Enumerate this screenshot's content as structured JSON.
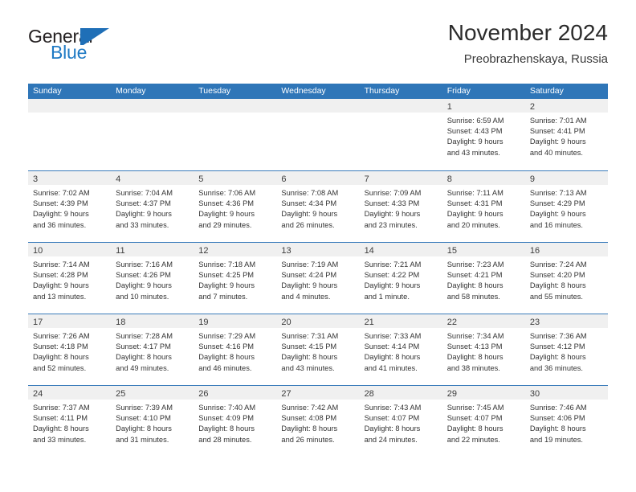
{
  "brand": {
    "name_part1": "General",
    "name_part2": "Blue",
    "mark": "blue-triangle-logo",
    "color_dark": "#231f20",
    "color_blue": "#1f7ac4"
  },
  "header": {
    "title": "November 2024",
    "location": "Preobrazhenskaya, Russia"
  },
  "theme": {
    "header_blue": "#2f76b8",
    "daynum_band": "#f0f0f0",
    "row_divider": "#3b7cbb",
    "text": "#333333"
  },
  "weekdays": [
    "Sunday",
    "Monday",
    "Tuesday",
    "Wednesday",
    "Thursday",
    "Friday",
    "Saturday"
  ],
  "weeks": [
    [
      {
        "day": "",
        "sunrise": "",
        "sunset": "",
        "daylight1": "",
        "daylight2": ""
      },
      {
        "day": "",
        "sunrise": "",
        "sunset": "",
        "daylight1": "",
        "daylight2": ""
      },
      {
        "day": "",
        "sunrise": "",
        "sunset": "",
        "daylight1": "",
        "daylight2": ""
      },
      {
        "day": "",
        "sunrise": "",
        "sunset": "",
        "daylight1": "",
        "daylight2": ""
      },
      {
        "day": "",
        "sunrise": "",
        "sunset": "",
        "daylight1": "",
        "daylight2": ""
      },
      {
        "day": "1",
        "sunrise": "Sunrise: 6:59 AM",
        "sunset": "Sunset: 4:43 PM",
        "daylight1": "Daylight: 9 hours",
        "daylight2": "and 43 minutes."
      },
      {
        "day": "2",
        "sunrise": "Sunrise: 7:01 AM",
        "sunset": "Sunset: 4:41 PM",
        "daylight1": "Daylight: 9 hours",
        "daylight2": "and 40 minutes."
      }
    ],
    [
      {
        "day": "3",
        "sunrise": "Sunrise: 7:02 AM",
        "sunset": "Sunset: 4:39 PM",
        "daylight1": "Daylight: 9 hours",
        "daylight2": "and 36 minutes."
      },
      {
        "day": "4",
        "sunrise": "Sunrise: 7:04 AM",
        "sunset": "Sunset: 4:37 PM",
        "daylight1": "Daylight: 9 hours",
        "daylight2": "and 33 minutes."
      },
      {
        "day": "5",
        "sunrise": "Sunrise: 7:06 AM",
        "sunset": "Sunset: 4:36 PM",
        "daylight1": "Daylight: 9 hours",
        "daylight2": "and 29 minutes."
      },
      {
        "day": "6",
        "sunrise": "Sunrise: 7:08 AM",
        "sunset": "Sunset: 4:34 PM",
        "daylight1": "Daylight: 9 hours",
        "daylight2": "and 26 minutes."
      },
      {
        "day": "7",
        "sunrise": "Sunrise: 7:09 AM",
        "sunset": "Sunset: 4:33 PM",
        "daylight1": "Daylight: 9 hours",
        "daylight2": "and 23 minutes."
      },
      {
        "day": "8",
        "sunrise": "Sunrise: 7:11 AM",
        "sunset": "Sunset: 4:31 PM",
        "daylight1": "Daylight: 9 hours",
        "daylight2": "and 20 minutes."
      },
      {
        "day": "9",
        "sunrise": "Sunrise: 7:13 AM",
        "sunset": "Sunset: 4:29 PM",
        "daylight1": "Daylight: 9 hours",
        "daylight2": "and 16 minutes."
      }
    ],
    [
      {
        "day": "10",
        "sunrise": "Sunrise: 7:14 AM",
        "sunset": "Sunset: 4:28 PM",
        "daylight1": "Daylight: 9 hours",
        "daylight2": "and 13 minutes."
      },
      {
        "day": "11",
        "sunrise": "Sunrise: 7:16 AM",
        "sunset": "Sunset: 4:26 PM",
        "daylight1": "Daylight: 9 hours",
        "daylight2": "and 10 minutes."
      },
      {
        "day": "12",
        "sunrise": "Sunrise: 7:18 AM",
        "sunset": "Sunset: 4:25 PM",
        "daylight1": "Daylight: 9 hours",
        "daylight2": "and 7 minutes."
      },
      {
        "day": "13",
        "sunrise": "Sunrise: 7:19 AM",
        "sunset": "Sunset: 4:24 PM",
        "daylight1": "Daylight: 9 hours",
        "daylight2": "and 4 minutes."
      },
      {
        "day": "14",
        "sunrise": "Sunrise: 7:21 AM",
        "sunset": "Sunset: 4:22 PM",
        "daylight1": "Daylight: 9 hours",
        "daylight2": "and 1 minute."
      },
      {
        "day": "15",
        "sunrise": "Sunrise: 7:23 AM",
        "sunset": "Sunset: 4:21 PM",
        "daylight1": "Daylight: 8 hours",
        "daylight2": "and 58 minutes."
      },
      {
        "day": "16",
        "sunrise": "Sunrise: 7:24 AM",
        "sunset": "Sunset: 4:20 PM",
        "daylight1": "Daylight: 8 hours",
        "daylight2": "and 55 minutes."
      }
    ],
    [
      {
        "day": "17",
        "sunrise": "Sunrise: 7:26 AM",
        "sunset": "Sunset: 4:18 PM",
        "daylight1": "Daylight: 8 hours",
        "daylight2": "and 52 minutes."
      },
      {
        "day": "18",
        "sunrise": "Sunrise: 7:28 AM",
        "sunset": "Sunset: 4:17 PM",
        "daylight1": "Daylight: 8 hours",
        "daylight2": "and 49 minutes."
      },
      {
        "day": "19",
        "sunrise": "Sunrise: 7:29 AM",
        "sunset": "Sunset: 4:16 PM",
        "daylight1": "Daylight: 8 hours",
        "daylight2": "and 46 minutes."
      },
      {
        "day": "20",
        "sunrise": "Sunrise: 7:31 AM",
        "sunset": "Sunset: 4:15 PM",
        "daylight1": "Daylight: 8 hours",
        "daylight2": "and 43 minutes."
      },
      {
        "day": "21",
        "sunrise": "Sunrise: 7:33 AM",
        "sunset": "Sunset: 4:14 PM",
        "daylight1": "Daylight: 8 hours",
        "daylight2": "and 41 minutes."
      },
      {
        "day": "22",
        "sunrise": "Sunrise: 7:34 AM",
        "sunset": "Sunset: 4:13 PM",
        "daylight1": "Daylight: 8 hours",
        "daylight2": "and 38 minutes."
      },
      {
        "day": "23",
        "sunrise": "Sunrise: 7:36 AM",
        "sunset": "Sunset: 4:12 PM",
        "daylight1": "Daylight: 8 hours",
        "daylight2": "and 36 minutes."
      }
    ],
    [
      {
        "day": "24",
        "sunrise": "Sunrise: 7:37 AM",
        "sunset": "Sunset: 4:11 PM",
        "daylight1": "Daylight: 8 hours",
        "daylight2": "and 33 minutes."
      },
      {
        "day": "25",
        "sunrise": "Sunrise: 7:39 AM",
        "sunset": "Sunset: 4:10 PM",
        "daylight1": "Daylight: 8 hours",
        "daylight2": "and 31 minutes."
      },
      {
        "day": "26",
        "sunrise": "Sunrise: 7:40 AM",
        "sunset": "Sunset: 4:09 PM",
        "daylight1": "Daylight: 8 hours",
        "daylight2": "and 28 minutes."
      },
      {
        "day": "27",
        "sunrise": "Sunrise: 7:42 AM",
        "sunset": "Sunset: 4:08 PM",
        "daylight1": "Daylight: 8 hours",
        "daylight2": "and 26 minutes."
      },
      {
        "day": "28",
        "sunrise": "Sunrise: 7:43 AM",
        "sunset": "Sunset: 4:07 PM",
        "daylight1": "Daylight: 8 hours",
        "daylight2": "and 24 minutes."
      },
      {
        "day": "29",
        "sunrise": "Sunrise: 7:45 AM",
        "sunset": "Sunset: 4:07 PM",
        "daylight1": "Daylight: 8 hours",
        "daylight2": "and 22 minutes."
      },
      {
        "day": "30",
        "sunrise": "Sunrise: 7:46 AM",
        "sunset": "Sunset: 4:06 PM",
        "daylight1": "Daylight: 8 hours",
        "daylight2": "and 19 minutes."
      }
    ]
  ]
}
